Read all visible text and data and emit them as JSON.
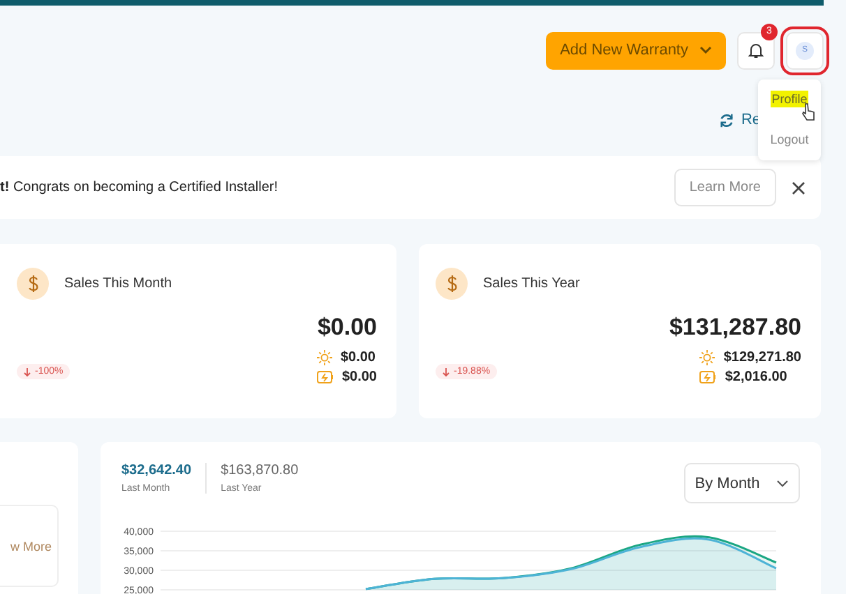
{
  "header": {
    "add_button": "Add New Warranty",
    "notifications": {
      "count": "3"
    },
    "avatar": {
      "initial": "S",
      "highlighted": true
    },
    "user_menu": {
      "items": [
        {
          "label": "Profile",
          "selected": true
        },
        {
          "label": "Logout",
          "selected": false
        }
      ]
    }
  },
  "refresh_link": "Re",
  "banner": {
    "message": "**t!** Congrats on becoming a Certified Installer!",
    "button": "Learn More"
  },
  "stat_cards": [
    {
      "title": "Sales This Month",
      "total": "$0.00",
      "solar": "$0.00",
      "battery": "$0.00",
      "change": "-100%"
    },
    {
      "title": "Sales This Year",
      "total": "$131,287.80",
      "solar": "$129,271.80",
      "battery": "$2,016.00",
      "change": "-19.88%"
    }
  ],
  "side_card": {
    "button": "w More"
  },
  "sales_chart": {
    "last_month": {
      "value": "$32,642.40",
      "label": "Last Month"
    },
    "last_year": {
      "value": "$163,870.80",
      "label": "Last Year"
    },
    "period": "By Month",
    "chart_data": {
      "type": "area",
      "ylim": [
        25000,
        40000
      ],
      "yticks": [
        {
          "value": 25000,
          "label": "25,000"
        },
        {
          "value": 30000,
          "label": "30,000"
        },
        {
          "value": 35000,
          "label": "35,000"
        },
        {
          "value": 40000,
          "label": "40,000"
        }
      ],
      "series": [
        {
          "color": "#1aa683",
          "values": [
            null,
            null,
            null,
            25200,
            27800,
            28000,
            30500,
            36500,
            38500,
            32000
          ]
        },
        {
          "color": "#4db3d6",
          "values": [
            null,
            null,
            null,
            25200,
            27800,
            28000,
            30300,
            35900,
            37900,
            30500
          ]
        }
      ]
    }
  }
}
